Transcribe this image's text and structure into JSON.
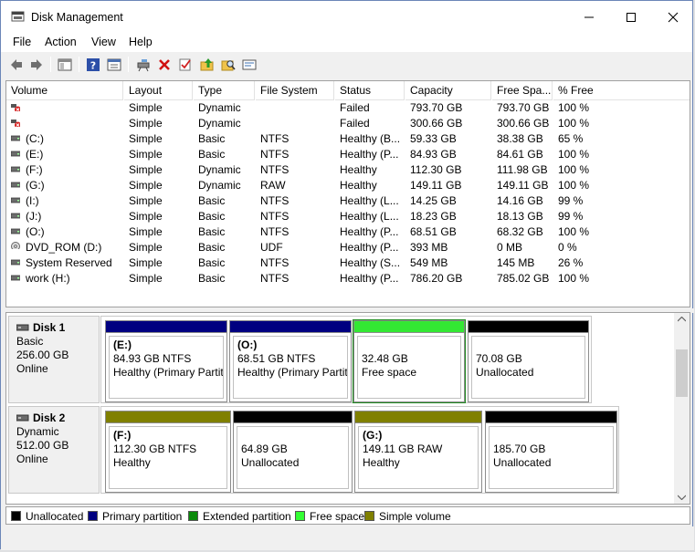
{
  "window": {
    "title": "Disk Management"
  },
  "menu": [
    "File",
    "Action",
    "View",
    "Help"
  ],
  "toolbar": [
    "back-icon",
    "forward-icon",
    "console-tree-icon",
    "help-icon",
    "properties-icon",
    "connect-disk-icon",
    "delete-icon",
    "check-icon",
    "folder-up-icon",
    "search-folder-icon",
    "settings-icon"
  ],
  "columns": [
    "Volume",
    "Layout",
    "Type",
    "File System",
    "Status",
    "Capacity",
    "Free Spa...",
    "% Free"
  ],
  "volumes": [
    {
      "name": "",
      "icon": "failed-volume-icon",
      "layout": "Simple",
      "type": "Dynamic",
      "fs": "",
      "status": "Failed",
      "capacity": "793.70 GB",
      "free": "793.70 GB",
      "pct": "100 %"
    },
    {
      "name": "",
      "icon": "failed-volume-icon",
      "layout": "Simple",
      "type": "Dynamic",
      "fs": "",
      "status": "Failed",
      "capacity": "300.66 GB",
      "free": "300.66 GB",
      "pct": "100 %"
    },
    {
      "name": "(C:)",
      "icon": "volume-icon",
      "layout": "Simple",
      "type": "Basic",
      "fs": "NTFS",
      "status": "Healthy (B...",
      "capacity": "59.33 GB",
      "free": "38.38 GB",
      "pct": "65 %"
    },
    {
      "name": "(E:)",
      "icon": "volume-icon",
      "layout": "Simple",
      "type": "Basic",
      "fs": "NTFS",
      "status": "Healthy (P...",
      "capacity": "84.93 GB",
      "free": "84.61 GB",
      "pct": "100 %"
    },
    {
      "name": "(F:)",
      "icon": "volume-icon",
      "layout": "Simple",
      "type": "Dynamic",
      "fs": "NTFS",
      "status": "Healthy",
      "capacity": "112.30 GB",
      "free": "111.98 GB",
      "pct": "100 %"
    },
    {
      "name": "(G:)",
      "icon": "volume-icon",
      "layout": "Simple",
      "type": "Dynamic",
      "fs": "RAW",
      "status": "Healthy",
      "capacity": "149.11 GB",
      "free": "149.11 GB",
      "pct": "100 %"
    },
    {
      "name": "(I:)",
      "icon": "volume-icon",
      "layout": "Simple",
      "type": "Basic",
      "fs": "NTFS",
      "status": "Healthy (L...",
      "capacity": "14.25 GB",
      "free": "14.16 GB",
      "pct": "99 %"
    },
    {
      "name": "(J:)",
      "icon": "volume-icon",
      "layout": "Simple",
      "type": "Basic",
      "fs": "NTFS",
      "status": "Healthy (L...",
      "capacity": "18.23 GB",
      "free": "18.13 GB",
      "pct": "99 %"
    },
    {
      "name": "(O:)",
      "icon": "volume-icon",
      "layout": "Simple",
      "type": "Basic",
      "fs": "NTFS",
      "status": "Healthy (P...",
      "capacity": "68.51 GB",
      "free": "68.32 GB",
      "pct": "100 %"
    },
    {
      "name": "DVD_ROM (D:)",
      "icon": "dvd-icon",
      "layout": "Simple",
      "type": "Basic",
      "fs": "UDF",
      "status": "Healthy (P...",
      "capacity": "393 MB",
      "free": "0 MB",
      "pct": "0 %"
    },
    {
      "name": "System Reserved",
      "icon": "volume-icon",
      "layout": "Simple",
      "type": "Basic",
      "fs": "NTFS",
      "status": "Healthy (S...",
      "capacity": "549 MB",
      "free": "145 MB",
      "pct": "26 %"
    },
    {
      "name": "work (H:)",
      "icon": "volume-icon",
      "layout": "Simple",
      "type": "Basic",
      "fs": "NTFS",
      "status": "Healthy (P...",
      "capacity": "786.20 GB",
      "free": "785.02 GB",
      "pct": "100 %"
    }
  ],
  "disks": [
    {
      "name": "Disk 1",
      "type": "Basic",
      "size": "256.00 GB",
      "status": "Online",
      "partitions": [
        {
          "label": "(E:)",
          "line1": "84.93 GB NTFS",
          "line2": "Healthy (Primary Partit",
          "color": "#000080"
        },
        {
          "label": "(O:)",
          "line1": "68.51 GB NTFS",
          "line2": "Healthy (Primary Partit",
          "color": "#000080"
        },
        {
          "label": "",
          "line1": "32.48 GB",
          "line2": "Free space",
          "color": "#33e833"
        },
        {
          "label": "",
          "line1": "70.08 GB",
          "line2": "Unallocated",
          "color": "#000000"
        }
      ]
    },
    {
      "name": "Disk 2",
      "type": "Dynamic",
      "size": "512.00 GB",
      "status": "Online",
      "partitions": [
        {
          "label": "(F:)",
          "line1": "112.30 GB NTFS",
          "line2": "Healthy",
          "color": "#808000"
        },
        {
          "label": "",
          "line1": "64.89 GB",
          "line2": "Unallocated",
          "color": "#000000"
        },
        {
          "label": "(G:)",
          "line1": "149.11 GB RAW",
          "line2": "Healthy",
          "color": "#808000"
        },
        {
          "label": "",
          "line1": "185.70 GB",
          "line2": "Unallocated",
          "color": "#000000"
        }
      ]
    }
  ],
  "legend": [
    {
      "label": "Unallocated",
      "color": "#000000"
    },
    {
      "label": "Primary partition",
      "color": "#000080"
    },
    {
      "label": "Extended partition",
      "color": "#0a8a0a"
    },
    {
      "label": "Free space",
      "color": "#33ff33"
    },
    {
      "label": "Simple volume",
      "color": "#808000"
    }
  ]
}
